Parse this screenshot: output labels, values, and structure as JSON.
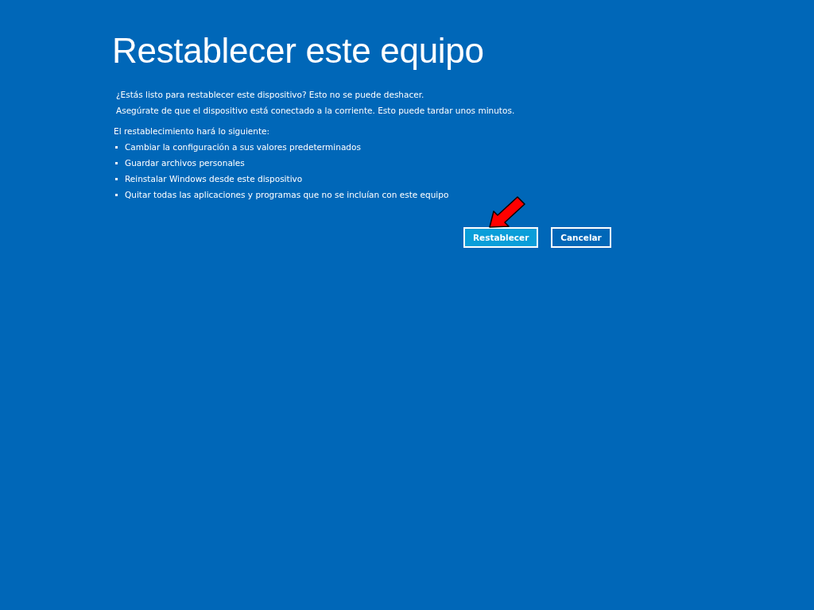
{
  "title": "Restablecer este equipo",
  "paragraphs": [
    "¿Estás listo para restablecer este dispositivo? Esto no se puede deshacer.",
    "Asegúrate de que el dispositivo está conectado a la corriente. Esto puede tardar unos minutos."
  ],
  "list_heading": "El restablecimiento hará lo siguiente:",
  "list_items": [
    "Cambiar la configuración a sus valores predeterminados",
    "Guardar archivos personales",
    "Reinstalar Windows desde este dispositivo",
    "Quitar todas las aplicaciones y programas que no se incluían con este equipo"
  ],
  "buttons": [
    {
      "label": "Restablecer",
      "kind": "primary",
      "annotated": true
    },
    {
      "label": "Cancelar",
      "kind": "secondary",
      "annotated": false
    }
  ]
}
